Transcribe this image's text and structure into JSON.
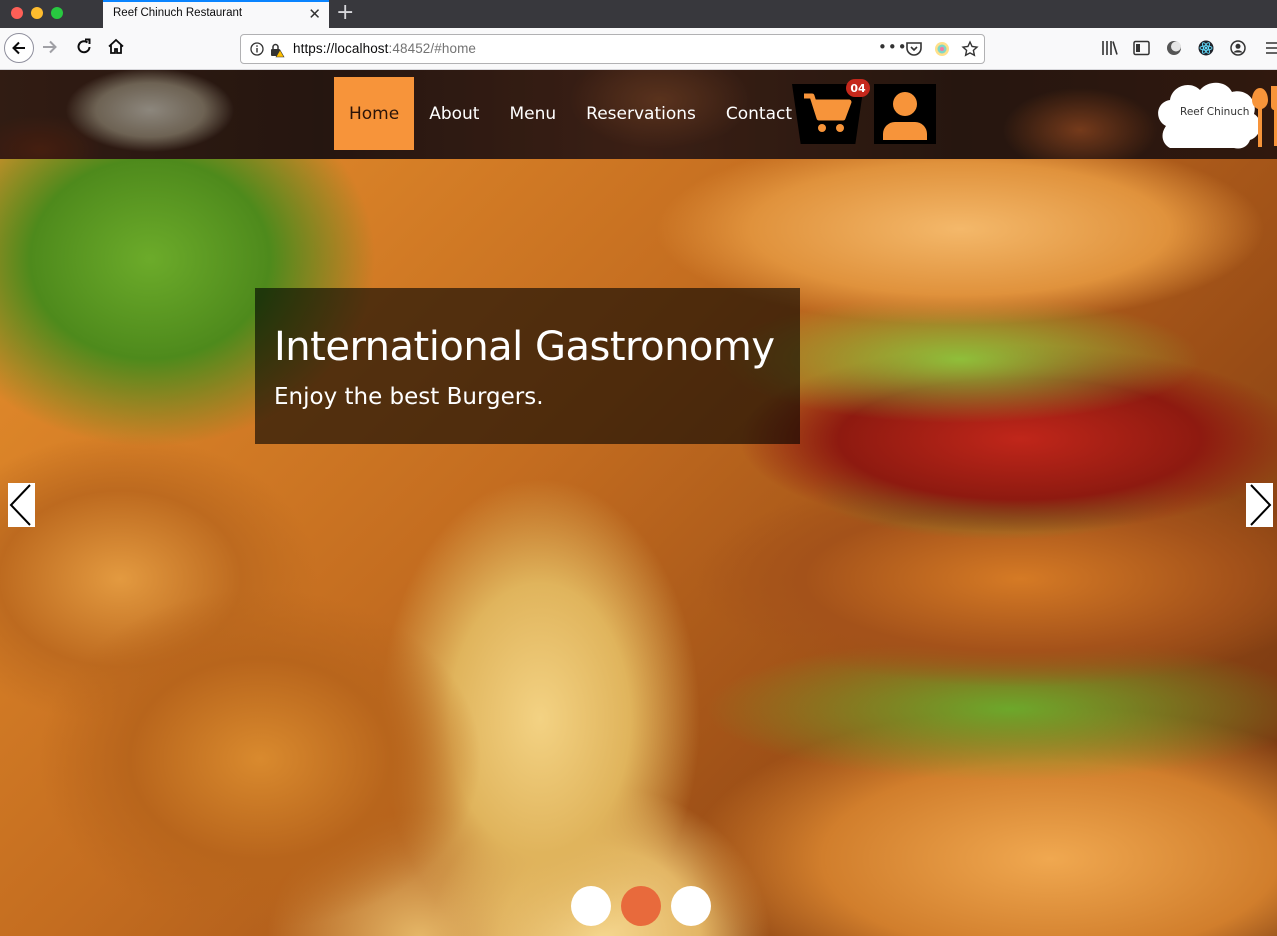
{
  "browser": {
    "tab_title": "Reef Chinuch Restaurant",
    "tab_close": "✕",
    "new_tab": "+",
    "url_host": "https://localhost",
    "url_rest": ":48452/#home",
    "url_more": "•••",
    "icons": [
      "back-icon",
      "forward-icon",
      "reload-icon",
      "home-icon",
      "info-icon",
      "lock-icon",
      "pocket-icon",
      "extension-icon",
      "bookmark-star-icon",
      "library-icon",
      "sidebar-icon",
      "dark-mode-icon",
      "react-devtools-icon",
      "account-icon",
      "menu-icon"
    ]
  },
  "site": {
    "nav": {
      "items": [
        {
          "label": "Home",
          "active": true
        },
        {
          "label": "About",
          "active": false
        },
        {
          "label": "Menu",
          "active": false
        },
        {
          "label": "Reservations",
          "active": false
        },
        {
          "label": "Contact",
          "active": false
        }
      ]
    },
    "cart_count": "04",
    "logo_text": "Reef Chinuch",
    "accent_color": "#f7943a",
    "badge_color": "#c5281c"
  },
  "hero": {
    "title": "International Gastronomy",
    "subtitle": "Enjoy the best Burgers.",
    "slides": 3,
    "active_slide": 2,
    "active_dot_color": "#e86a3c"
  }
}
